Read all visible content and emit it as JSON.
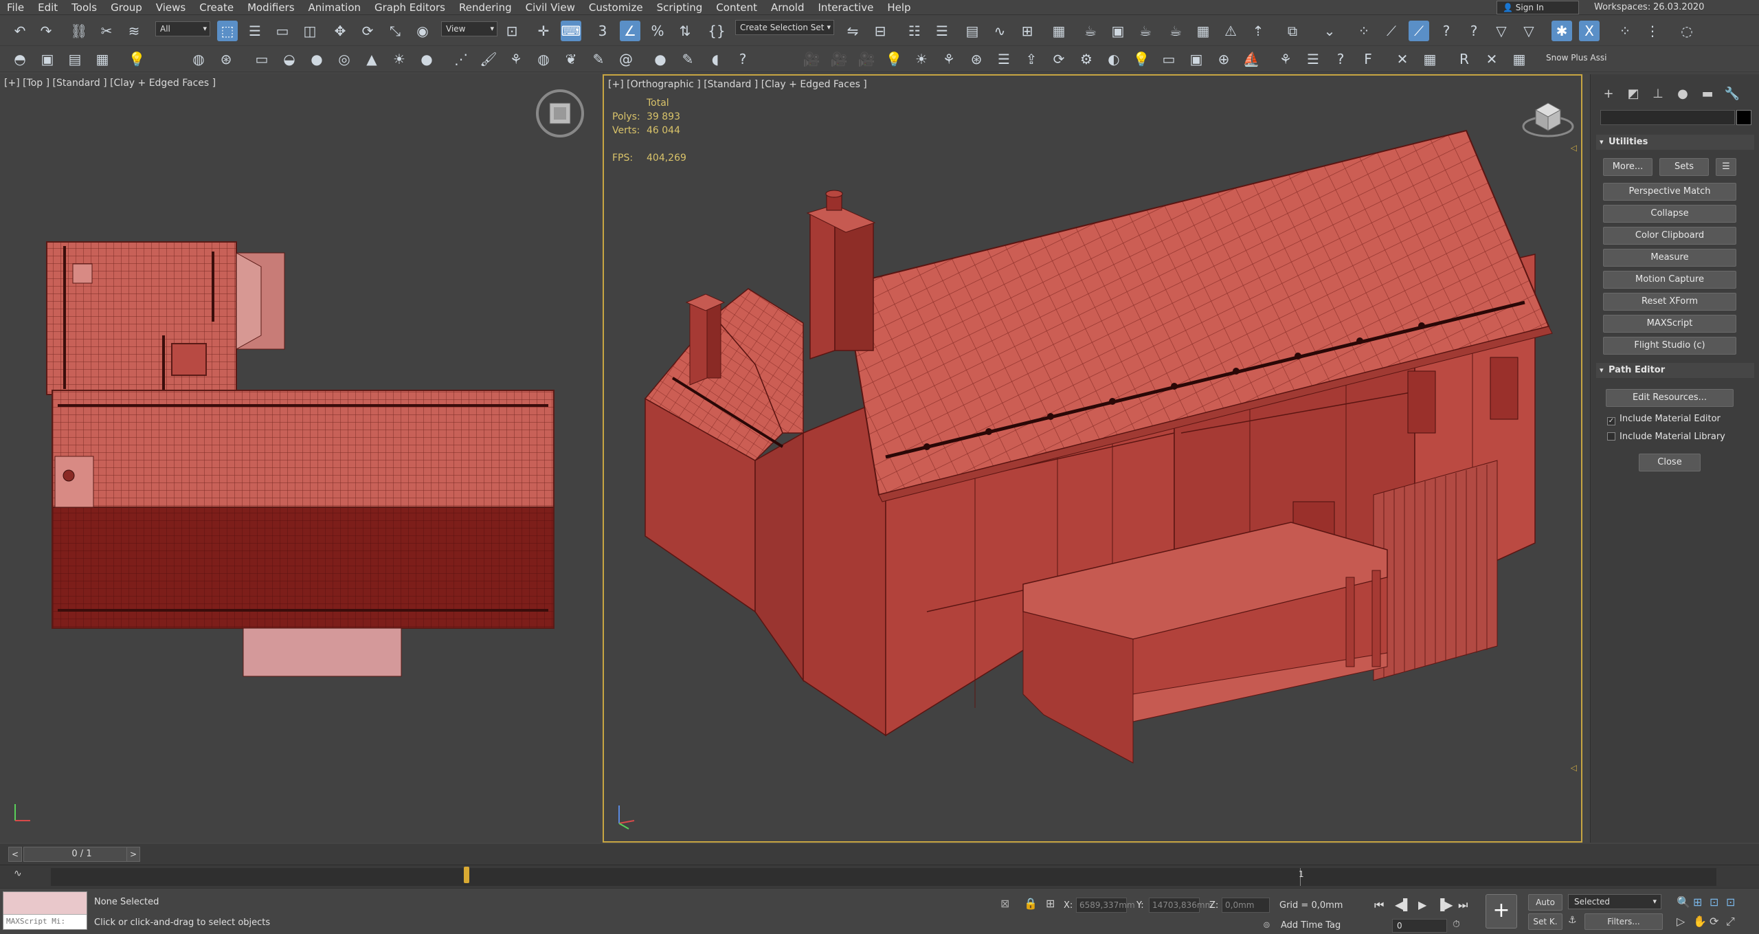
{
  "menu": [
    "File",
    "Edit",
    "Tools",
    "Group",
    "Views",
    "Create",
    "Modifiers",
    "Animation",
    "Graph Editors",
    "Rendering",
    "Civil View",
    "Customize",
    "Scripting",
    "Content",
    "Arnold",
    "Interactive",
    "Help"
  ],
  "account": {
    "signin_label": "Sign In"
  },
  "workspace": {
    "label": "Workspaces:",
    "value": "26.03.2020"
  },
  "toolbar1": {
    "filter_value": "All",
    "coord_system": "View",
    "selection_set": "Create Selection Set"
  },
  "toolbar2": {
    "overflow_label": "Snow Plus Assi"
  },
  "viewport_left": {
    "label": "[+] [Top ] [Standard ] [Clay + Edged Faces ]"
  },
  "viewport_right": {
    "label": "[+] [Orthographic ] [Standard ] [Clay + Edged Faces ]",
    "stats": {
      "total_label": "Total",
      "polys_label": "Polys:",
      "polys_value": "39 893",
      "verts_label": "Verts:",
      "verts_value": "46 044",
      "fps_label": "FPS:",
      "fps_value": "404,269"
    }
  },
  "command_panel": {
    "utilities_title": "Utilities",
    "more_label": "More...",
    "sets_label": "Sets",
    "utilities": [
      "Perspective Match",
      "Collapse",
      "Color Clipboard",
      "Measure",
      "Motion Capture",
      "Reset XForm",
      "MAXScript",
      "Flight Studio (c)"
    ],
    "path_editor_title": "Path Editor",
    "edit_resources_label": "Edit Resources...",
    "include_material_editor": "Include Material Editor",
    "include_material_library": "Include Material Library",
    "include_material_editor_checked": true,
    "include_material_library_checked": false,
    "close_label": "Close"
  },
  "time_slider": {
    "value": "0 / 1",
    "prev": "<",
    "next": ">"
  },
  "trackbar": {
    "tick_label": "1"
  },
  "status": {
    "maxscript_placeholder": "MAXScript Mi:",
    "selection": "None Selected",
    "prompt": "Click or click-and-drag to select objects",
    "x_label": "X:",
    "x_value": "6589,337mm",
    "y_label": "Y:",
    "y_value": "14703,836mm",
    "z_label": "Z:",
    "z_value": "0,0mm",
    "grid": "Grid = 0,0mm",
    "add_time_tag": "Add Time Tag",
    "auto_label": "Auto",
    "set_key_label": "Set K.",
    "key_mode_value": "Selected",
    "frame_value": "0",
    "filters_label": "Filters..."
  },
  "colors": {
    "accent": "#5a8fc7",
    "viewport_border": "#c8a642",
    "stats_text": "#d9c36a",
    "model_red": "#b8504a",
    "model_roof": "#c86158",
    "model_dark": "#7d1e1a"
  }
}
